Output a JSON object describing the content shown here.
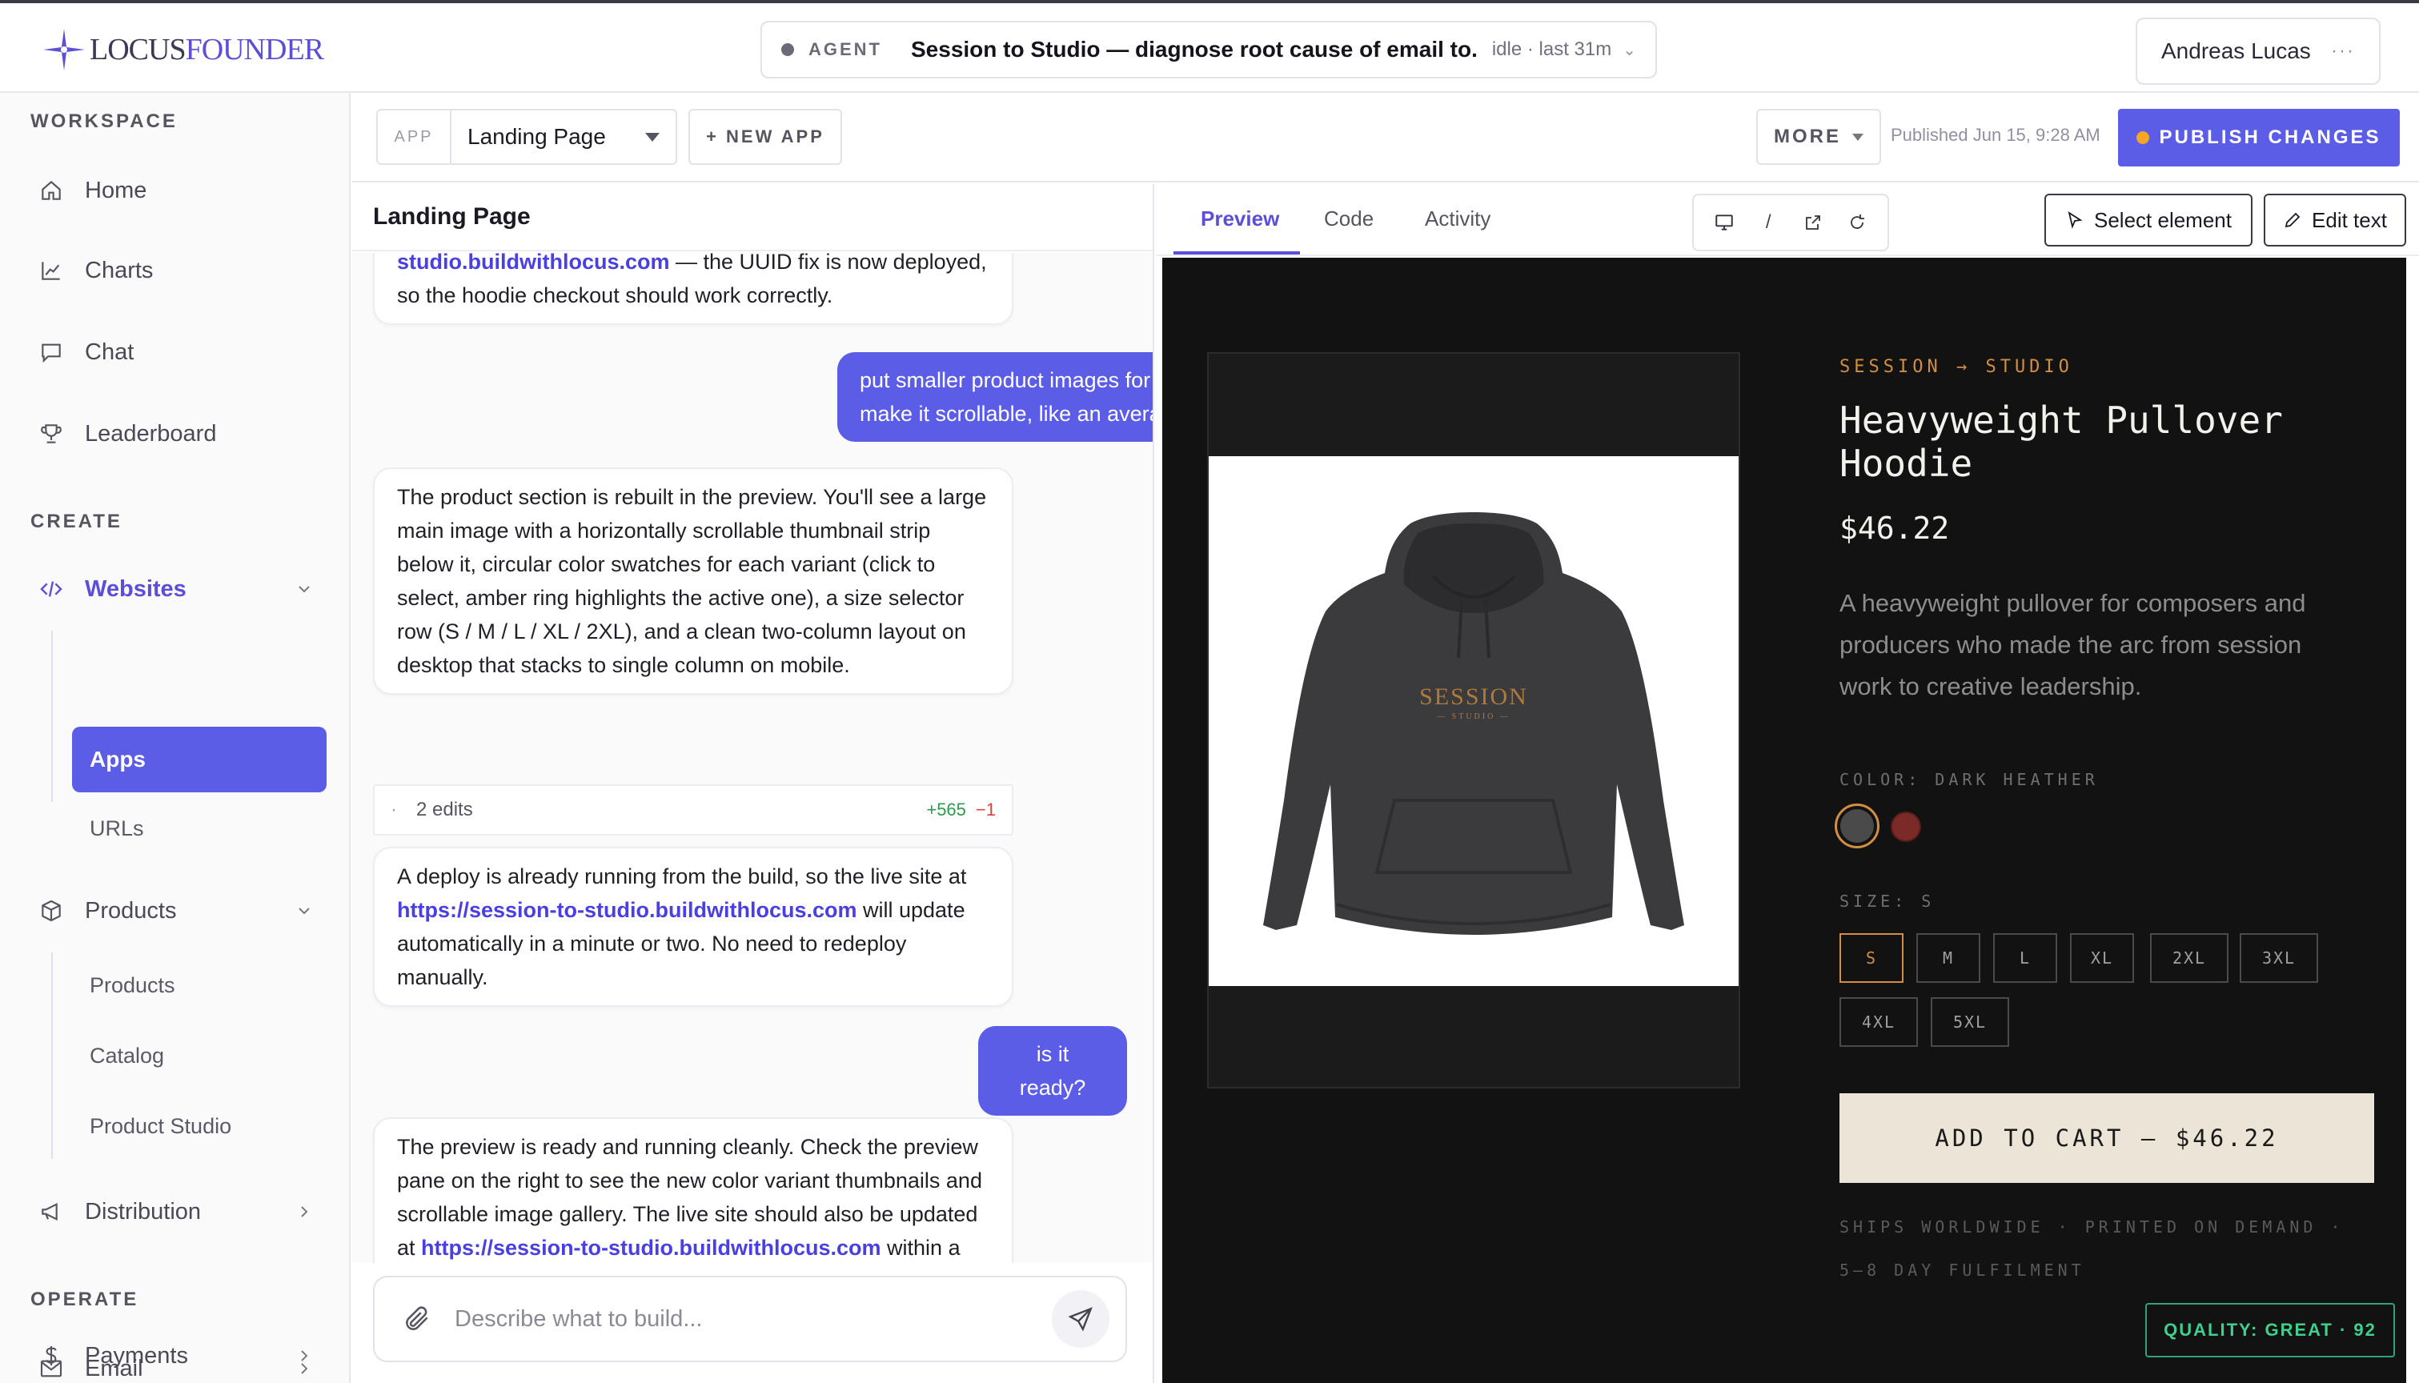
{
  "brand": {
    "logo_a": "LOCUS",
    "logo_b": "FOUNDER"
  },
  "agent": {
    "label": "AGENT",
    "title": "Session to Studio — diagnose root cause of email to...",
    "status": "idle · last 31m"
  },
  "user": {
    "name": "Andreas Lucas",
    "more": "···"
  },
  "sidebar": {
    "workspace_label": "WORKSPACE",
    "workspace_items": [
      {
        "label": "Home",
        "icon": "home-icon"
      },
      {
        "label": "Charts",
        "icon": "chart-icon"
      },
      {
        "label": "Chat",
        "icon": "chat-icon"
      },
      {
        "label": "Leaderboard",
        "icon": "trophy-icon"
      }
    ],
    "create_label": "CREATE",
    "websites": "Websites",
    "apps": "Apps",
    "urls": "URLs",
    "products": "Products",
    "products_sub": [
      "Products",
      "Catalog",
      "Product Studio"
    ],
    "distribution": "Distribution",
    "operate_label": "OPERATE",
    "email": "Email",
    "payments": "Payments"
  },
  "toolbar": {
    "app_tag": "APP",
    "app_value": "Landing Page",
    "new_app": "+ NEW APP",
    "more": "MORE",
    "published": "Published Jun 15, 9:28 AM",
    "publish": "PUBLISH CHANGES"
  },
  "chat": {
    "title": "Landing Page",
    "msg0_link": "studio.buildwithlocus.com",
    "msg0_text": " — the UUID fix is now deployed, so the hoodie checkout should work correctly.",
    "msg1": "put smaller product images for each color vairent available, make it scrollable, like an average shopify store",
    "msg2": "The product section is rebuilt in the preview. You'll see a large main image with a horizontally scrollable thumbnail strip below it, circular color swatches for each variant (click to select, amber ring highlights the active one), a size selector row (S / M / L / XL / 2XL), and a clean two-column layout on desktop that stacks to single column on mobile.",
    "edits_bullet": "·",
    "edits_label": "2 edits",
    "edits_plus": "+565",
    "edits_minus": "−1",
    "msg3_a": "A deploy is already running from the build, so the live site at ",
    "msg3_link": "https://session-to-studio.buildwithlocus.com",
    "msg3_b": " will update automatically in a minute or two. No need to redeploy manually.",
    "msg4": "is it ready?",
    "msg5_a": "The preview is ready and running cleanly. Check the preview pane on the right to see the new color variant thumbnails and scrollable image gallery. The live site should also be updated at ",
    "msg5_link": "https://session-to-studio.buildwithlocus.com",
    "msg5_b": " within a minute or two.",
    "composer_placeholder": "Describe what to build..."
  },
  "preview": {
    "tabs": [
      "Preview",
      "Code",
      "Activity"
    ],
    "device_sep": "/",
    "select_element": "Select element",
    "edit_text": "Edit text"
  },
  "store": {
    "kicker": "SESSION → STUDIO",
    "title": "Heavyweight Pullover Hoodie",
    "price": "$46.22",
    "description": "A heavyweight pullover for composers and producers who made the arc from session work to creative leadership.",
    "hoodie_print": "SESSION",
    "hoodie_print_sub": "— STUDIO —",
    "color_label": "COLOR: DARK HEATHER",
    "swatches": [
      "#4a4a4a",
      "#7a2a27"
    ],
    "size_label": "SIZE: S",
    "sizes": [
      "S",
      "M",
      "L",
      "XL",
      "2XL",
      "3XL",
      "4XL",
      "5XL"
    ],
    "add_to_cart": "ADD TO CART — $46.22",
    "ship_1": "SHIPS WORLDWIDE  ·  PRINTED ON DEMAND  ·",
    "ship_2": "5–8 DAY FULFILMENT"
  },
  "quality": "QUALITY: GREAT · 92",
  "colors": {
    "accent": "#5b5de6",
    "amber": "#d38e42",
    "store_bg": "#121212"
  }
}
